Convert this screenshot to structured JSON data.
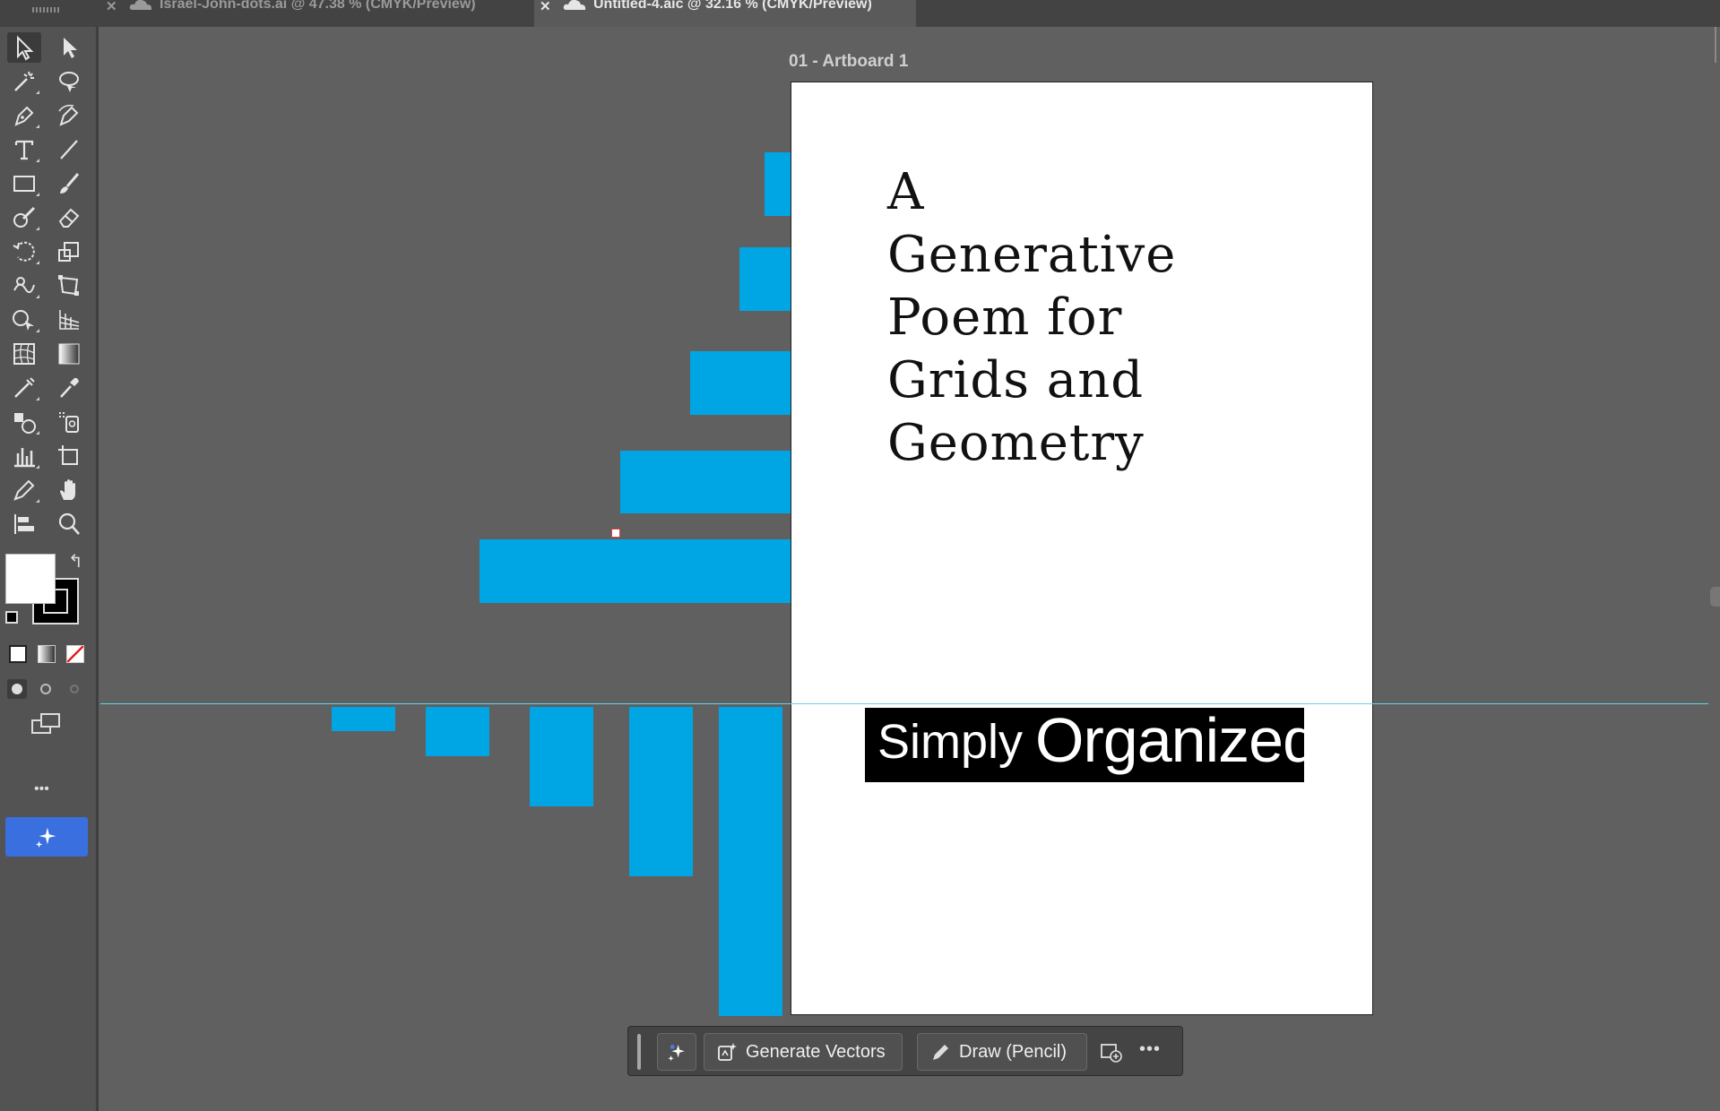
{
  "tabs": [
    {
      "label": "Israel-John-dots.ai @ 47.38 % (CMYK/Preview)",
      "active": false
    },
    {
      "label": "Untitled-4.aic @ 32.16 % (CMYK/Preview)",
      "active": true
    }
  ],
  "artboard": {
    "label": "01 - Artboard 1"
  },
  "poem": {
    "title_lines": [
      "A",
      "Generative",
      "Poem for",
      "Grids and",
      "Geometry"
    ],
    "subtitle_small": "Simply",
    "subtitle_large": "Organized"
  },
  "context_bar": {
    "generate_label": "Generate Vectors",
    "draw_label": "Draw (Pencil)"
  },
  "toolbar": {
    "more_label": "•••"
  },
  "colors": {
    "accent_bar": "#00a6e4",
    "guide": "#5fd6e8",
    "ai_button": "#3a6fe0"
  }
}
